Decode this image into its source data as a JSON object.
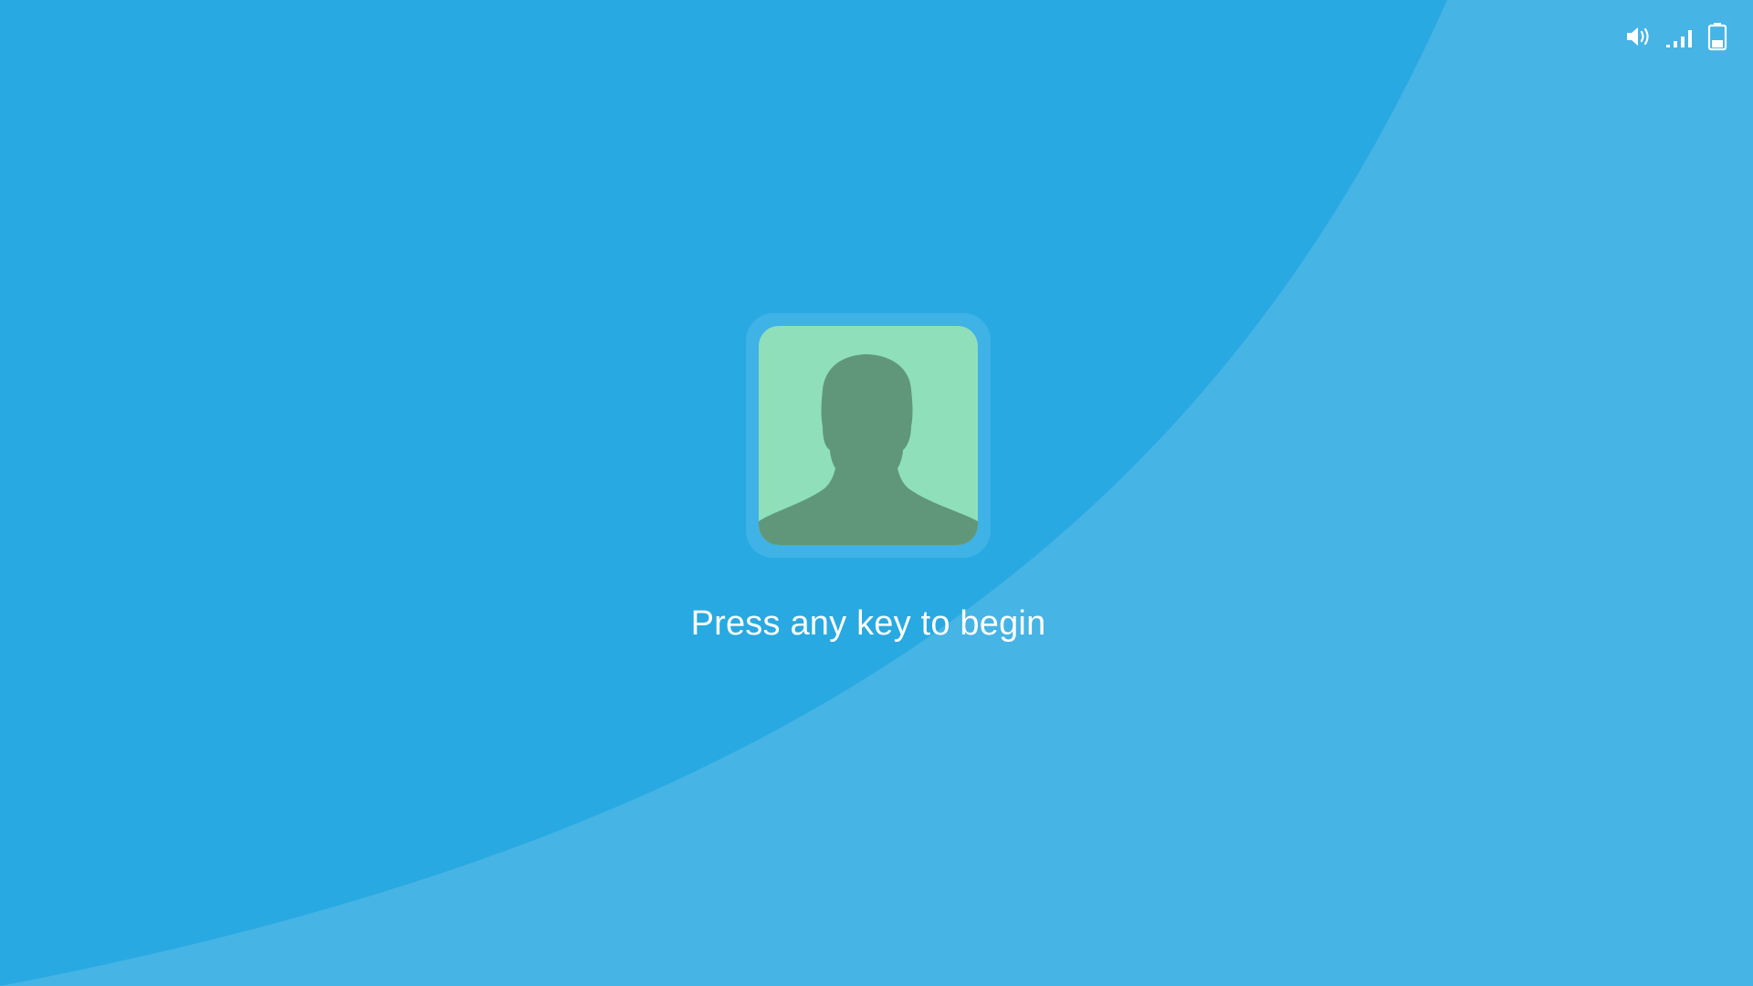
{
  "screen": {
    "type": "lock-screen",
    "background_primary": "#28a9e1",
    "background_secondary": "#46b4e5"
  },
  "status_tray": {
    "icons": [
      "volume-icon",
      "signal-icon",
      "battery-icon"
    ],
    "icon_color": "#ffffff",
    "signal_bars_active": 3,
    "signal_bars_total": 4,
    "battery_level": 0.35
  },
  "user": {
    "avatar": "user-silhouette-icon",
    "avatar_bg": "#8fdfbb",
    "avatar_fg": "#60977b",
    "avatar_frame": "#3fb2e6"
  },
  "prompt": {
    "text": "Press any key to begin"
  }
}
